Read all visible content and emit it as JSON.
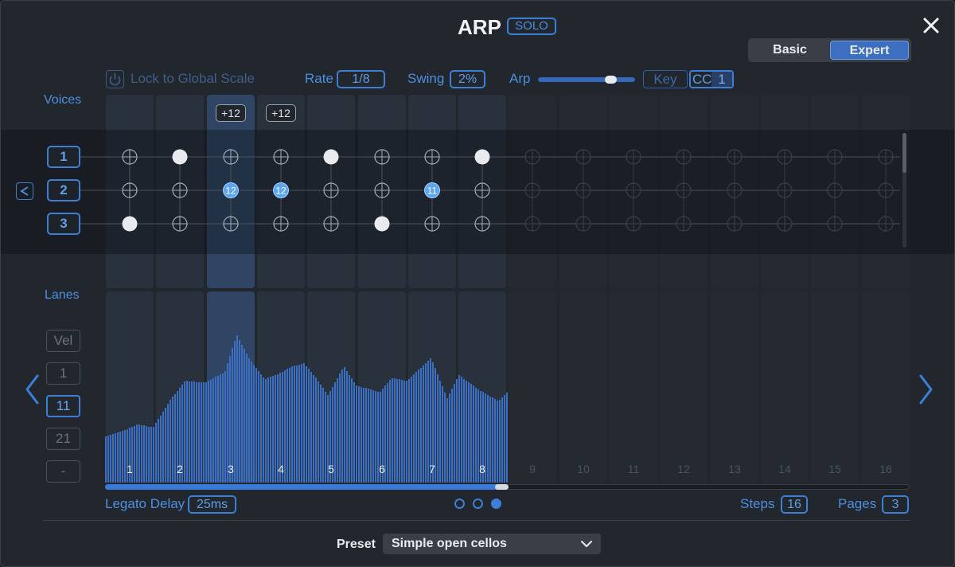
{
  "header": {
    "title": "ARP",
    "solo_label": "SOLO",
    "close_icon": "close-icon"
  },
  "mode_toggle": {
    "basic_label": "Basic",
    "expert_label": "Expert",
    "selected": "Expert"
  },
  "toolbar": {
    "lock_label": "Lock to Global Scale",
    "rate_label": "Rate",
    "rate_value": "1/8",
    "swing_label": "Swing",
    "swing_value": "2%",
    "arp_label": "Arp",
    "arp_slider_fraction": 0.75,
    "key_label": "Key",
    "cc_label": "CC",
    "cc_value": "1"
  },
  "voices": {
    "label": "Voices",
    "buttons": [
      "1",
      "2",
      "3"
    ],
    "transpose_badges": [
      {
        "step": 3,
        "text": "+12"
      },
      {
        "step": 4,
        "text": "+12"
      }
    ],
    "voice2_notes": [
      {
        "step": 3,
        "text": "12"
      },
      {
        "step": 4,
        "text": "12"
      },
      {
        "step": 7,
        "text": "11"
      }
    ]
  },
  "lanes": {
    "label": "Lanes",
    "buttons": [
      {
        "label": "Vel",
        "active": false
      },
      {
        "label": "1",
        "active": false
      },
      {
        "label": "11",
        "active": true
      },
      {
        "label": "21",
        "active": false
      },
      {
        "label": "-",
        "active": false
      }
    ]
  },
  "steps": {
    "labels": [
      "1",
      "2",
      "3",
      "4",
      "5",
      "6",
      "7",
      "8",
      "9",
      "10",
      "11",
      "12",
      "13",
      "14",
      "15",
      "16"
    ],
    "active_count": 8,
    "selected_step": 3
  },
  "footer": {
    "legato_label": "Legato Delay",
    "legato_value": "25ms",
    "steps_label": "Steps",
    "steps_value": "16",
    "pages_label": "Pages",
    "pages_value": "3",
    "page_dots": 3,
    "current_page": 3
  },
  "preset": {
    "label": "Preset",
    "value": "Simple open cellos"
  },
  "colors": {
    "accent": "#3d7fd6",
    "bar": "#3a6fc4",
    "selected_column": "#2f4563"
  }
}
